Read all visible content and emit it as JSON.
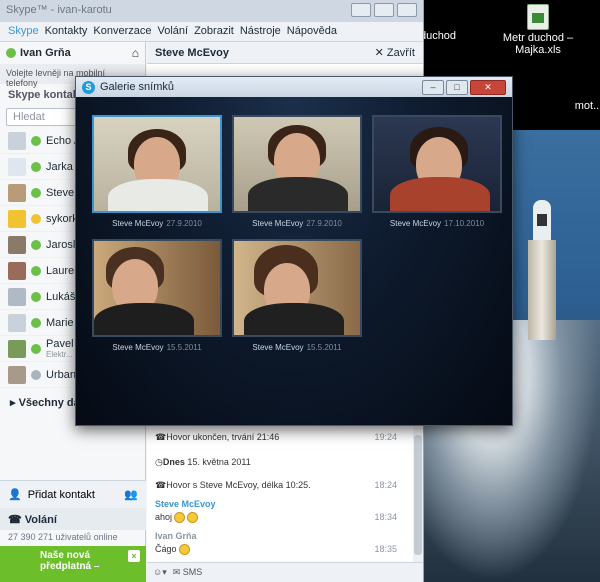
{
  "desktop": {
    "icons": [
      {
        "label": "duchod"
      },
      {
        "label": "Metr duchod – Majka.xls"
      },
      {
        "label": "mot.."
      }
    ]
  },
  "skype": {
    "window_title": "Skype™ - ivan-karotu",
    "menu": [
      "Skype",
      "Kontakty",
      "Konverzace",
      "Volání",
      "Zobrazit",
      "Nástroje",
      "Nápověda"
    ],
    "user_name": "Ivan Grňa",
    "promo_text": "Volejte levněji na mobilní telefony",
    "contacts_heading": "Skype kontakty",
    "search_placeholder": "Hledat",
    "contacts": [
      {
        "name": "Echo / ...",
        "status": "online"
      },
      {
        "name": "Jarka ...",
        "status": "online"
      },
      {
        "name": "Steve ...",
        "status": "online"
      },
      {
        "name": "sykork...",
        "status": "away"
      },
      {
        "name": "Jarosl...",
        "status": "online"
      },
      {
        "name": "Lauren...",
        "status": "online"
      },
      {
        "name": "Lukáš ...",
        "status": "online"
      },
      {
        "name": "Marie ...",
        "status": "online"
      },
      {
        "name": "Pavel ...",
        "status": "online",
        "sub": "Elektr..."
      },
      {
        "name": "Urban...",
        "status": "offline"
      }
    ],
    "all_groups": "Všechny další...",
    "add_contact": "Přidat kontakt",
    "calls_heading": "Volání",
    "online_count": "27 390 271 uživatelů online",
    "promo2_line1": "Naše nová",
    "promo2_line2": "předplatná –",
    "chat_name": "Steve McEvoy",
    "chat_close": "Zavřít",
    "messages": {
      "ended_text": "Hovor ukončen, trvání 21:46",
      "ended_time": "19:24",
      "date_bold": "Dnes",
      "date_rest": "15. května 2011",
      "call_text": "Hovor s Steve McEvoy, délka 10:25.",
      "call_time": "18:24",
      "sender1": "Steve McEvoy",
      "msg1": "ahoj",
      "time1": "18:34",
      "sender2": "Ivan Grňa",
      "msg2": "Čágo",
      "time2": "18:35"
    },
    "footer_sms": "SMS"
  },
  "gallery": {
    "title": "Galerie snímků",
    "photos": [
      {
        "name": "Steve McEvoy",
        "date": "27.9.2010"
      },
      {
        "name": "Steve McEvoy",
        "date": "27.9.2010"
      },
      {
        "name": "Steve McEvoy",
        "date": "17.10.2010"
      },
      {
        "name": "Steve McEvoy",
        "date": "15.5.2011"
      },
      {
        "name": "Steve McEvoy",
        "date": "15.5.2011"
      }
    ]
  },
  "colors": {
    "skype_blue": "#1f9bde",
    "online_green": "#6cc04a",
    "away_yellow": "#f1c232",
    "close_red": "#c8453a"
  }
}
